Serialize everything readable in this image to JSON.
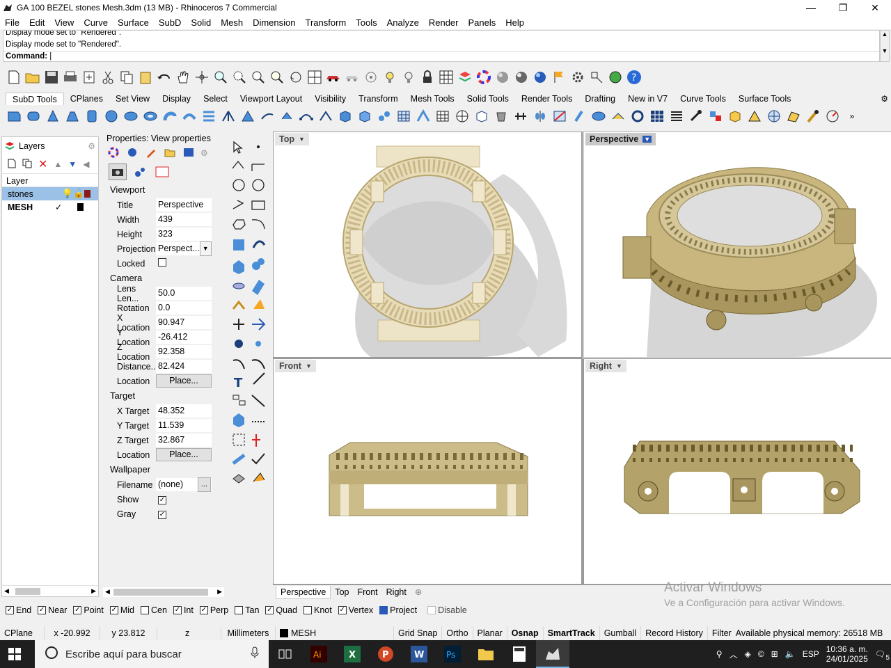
{
  "window": {
    "title": "GA 100 BEZEL stones Mesh.3dm (13 MB) - Rhinoceros 7 Commercial",
    "minimize": "—",
    "restore": "❐",
    "close": "✕"
  },
  "menu": [
    "File",
    "Edit",
    "View",
    "Curve",
    "Surface",
    "SubD",
    "Solid",
    "Mesh",
    "Dimension",
    "Transform",
    "Tools",
    "Analyze",
    "Render",
    "Panels",
    "Help"
  ],
  "command": {
    "history_1": "Display mode set to \"Rendered\".",
    "history_2": "Display mode set to \"Rendered\".",
    "prompt": "Command:"
  },
  "toolbar_tabs": [
    "SubD Tools",
    "CPlanes",
    "Set View",
    "Display",
    "Select",
    "Viewport Layout",
    "Visibility",
    "Transform",
    "Mesh Tools",
    "Solid Tools",
    "Render Tools",
    "Drafting",
    "New in V7",
    "Curve Tools",
    "Surface Tools"
  ],
  "layers": {
    "title": "Layers",
    "header": "Layer",
    "rows": [
      {
        "name": "stones",
        "selected": true,
        "color": "#8b1a1a",
        "check": ""
      },
      {
        "name": "MESH",
        "selected": false,
        "color": "#000000",
        "check": "✓"
      }
    ]
  },
  "properties": {
    "title": "Properties: View properties",
    "sections": {
      "viewport": "Viewport",
      "camera": "Camera",
      "target": "Target",
      "wallpaper": "Wallpaper"
    },
    "viewport": {
      "title_label": "Title",
      "title_value": "Perspective",
      "width_label": "Width",
      "width_value": "439",
      "height_label": "Height",
      "height_value": "323",
      "projection_label": "Projection",
      "projection_value": "Perspect...",
      "locked_label": "Locked"
    },
    "camera": {
      "lens_label": "Lens Len...",
      "lens_value": "50.0",
      "rotation_label": "Rotation",
      "rotation_value": "0.0",
      "xloc_label": "X Location",
      "xloc_value": "90.947",
      "yloc_label": "Y Location",
      "yloc_value": "-26.412",
      "zloc_label": "Z Location",
      "zloc_value": "92.358",
      "dist_label": "Distance...",
      "dist_value": "82.424",
      "loc_label": "Location",
      "loc_button": "Place..."
    },
    "target": {
      "xt_label": "X Target",
      "xt_value": "48.352",
      "yt_label": "Y Target",
      "yt_value": "11.539",
      "zt_label": "Z Target",
      "zt_value": "32.867",
      "loc_label": "Location",
      "loc_button": "Place..."
    },
    "wallpaper": {
      "file_label": "Filename",
      "file_value": "(none)",
      "file_button": "...",
      "show_label": "Show",
      "gray_label": "Gray"
    }
  },
  "viewports": {
    "top": "Top",
    "perspective": "Perspective",
    "front": "Front",
    "right": "Right"
  },
  "viewport_tabs": [
    "Perspective",
    "Top",
    "Front",
    "Right"
  ],
  "viewport_tab_add": "⊕",
  "osnaps": [
    {
      "label": "End",
      "checked": true
    },
    {
      "label": "Near",
      "checked": true
    },
    {
      "label": "Point",
      "checked": true
    },
    {
      "label": "Mid",
      "checked": true
    },
    {
      "label": "Cen",
      "checked": false
    },
    {
      "label": "Int",
      "checked": true
    },
    {
      "label": "Perp",
      "checked": true
    },
    {
      "label": "Tan",
      "checked": false
    },
    {
      "label": "Quad",
      "checked": true
    },
    {
      "label": "Knot",
      "checked": false
    },
    {
      "label": "Vertex",
      "checked": true
    },
    {
      "label": "Project",
      "checked": true
    },
    {
      "label": "Disable",
      "checked": false
    }
  ],
  "watermark": {
    "line1": "Activar Windows",
    "line2": "Ve a Configuración para activar Windows."
  },
  "status": {
    "cplane": "CPlane",
    "x": "x -20.992",
    "y": "y 23.812",
    "z": "z",
    "units": "Millimeters",
    "layer": "MESH",
    "grid_snap": "Grid Snap",
    "ortho": "Ortho",
    "planar": "Planar",
    "osnap": "Osnap",
    "smarttrack": "SmartTrack",
    "gumball": "Gumball",
    "record_history": "Record History",
    "filter": "Filter",
    "memory": "Available physical memory: 26518 MB"
  },
  "taskbar": {
    "search_placeholder": "Escribe aquí para buscar",
    "lang": "ESP",
    "time": "10:36 a. m.",
    "date": "24/01/2025",
    "notif_count": "5"
  },
  "colors": {
    "gold": "#c8b98a",
    "gold_dark": "#8a7c4a",
    "selection": "#9bc1e6",
    "taskbar": "#1f1f1f"
  }
}
